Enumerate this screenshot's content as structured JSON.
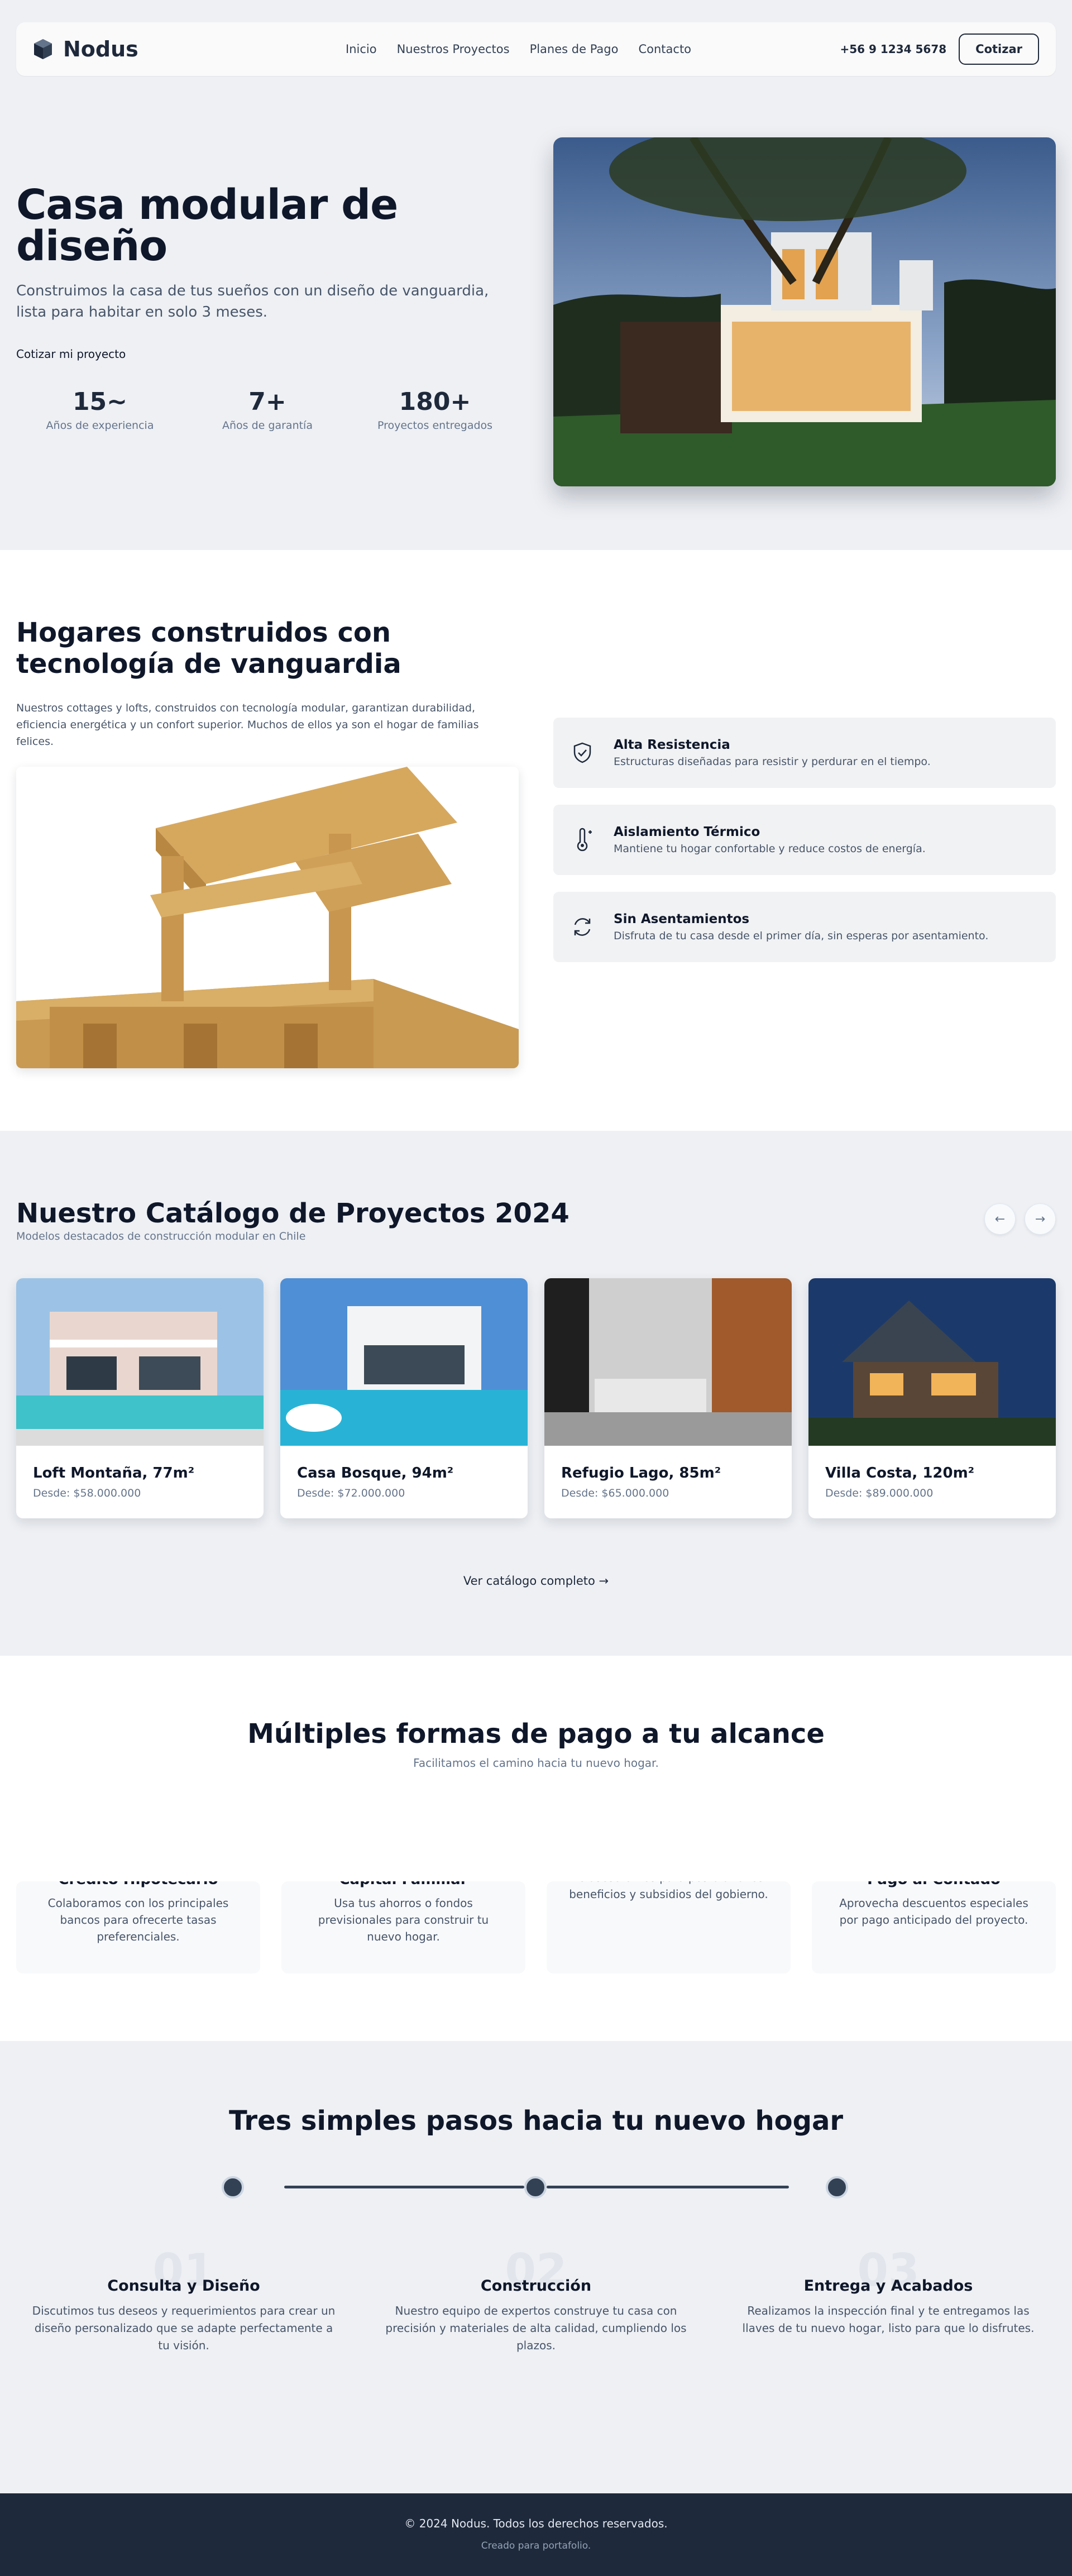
{
  "nav": {
    "logo_text": "Nodus",
    "links": [
      "Inicio",
      "Nuestros Proyectos",
      "Planes de Pago",
      "Contacto"
    ],
    "phone": "+56 9 1234 5678",
    "cta": "Cotizar"
  },
  "hero": {
    "title": "Casa modular de diseño",
    "subtitle": "Construimos la casa de tus sueños con un diseño de vanguardia, lista para habitar en solo 3 meses.",
    "link": "Cotizar mi proyecto",
    "stats": [
      {
        "value": "15~",
        "label": "Años de experiencia"
      },
      {
        "value": "7+",
        "label": "Años de garantía"
      },
      {
        "value": "180+",
        "label": "Proyectos entregados"
      }
    ]
  },
  "features": {
    "title": "Hogares construidos con tecnología de vanguardia",
    "description": "Nuestros cottages y lofts, construidos con tecnología modular, garantizan durabilidad, eficiencia energética y un confort superior. Muchos de ellos ya son el hogar de familias felices.",
    "items": [
      {
        "title": "Alta Resistencia",
        "desc": "Estructuras diseñadas para resistir y perdurar en el tiempo.",
        "icon": "shield-icon"
      },
      {
        "title": "Aislamiento Térmico",
        "desc": "Mantiene tu hogar confortable y reduce costos de energía.",
        "icon": "thermometer-icon"
      },
      {
        "title": "Sin Asentamientos",
        "desc": "Disfruta de tu casa desde el primer día, sin esperas por asentamiento.",
        "icon": "refresh-icon"
      }
    ]
  },
  "catalog": {
    "title": "Nuestro Catálogo de Proyectos 2024",
    "subtitle": "Modelos destacados de construcción modular en Chile",
    "prev": "←",
    "next": "→",
    "cards": [
      {
        "title": "Loft Montaña, 77m²",
        "price": "Desde: $58.000.000"
      },
      {
        "title": "Casa Bosque, 94m²",
        "price": "Desde: $72.000.000"
      },
      {
        "title": "Refugio Lago, 85m²",
        "price": "Desde: $65.000.000"
      },
      {
        "title": "Villa Costa, 120m²",
        "price": "Desde: $89.000.000"
      }
    ],
    "link": "Ver catálogo completo →"
  },
  "payment": {
    "title": "Múltiples formas de pago a tu alcance",
    "subtitle": "Facilitamos el camino hacia tu nuevo hogar.",
    "cards": [
      {
        "title": "Crédito Hipotecario",
        "desc": "Colaboramos con los principales bancos para ofrecerte tasas preferenciales."
      },
      {
        "title": "Capital Familiar",
        "desc": "Usa tus ahorros o fondos previsionales para construir tu nuevo hogar."
      },
      {
        "title": "",
        "desc": "Te asesoramos para postular a los beneficios y subsidios del gobierno."
      },
      {
        "title": "Pago al Contado",
        "desc": "Aprovecha descuentos especiales por pago anticipado del proyecto."
      }
    ]
  },
  "steps": {
    "title": "Tres simples pasos hacia tu nuevo hogar",
    "items": [
      {
        "num": "01",
        "title": "Consulta y Diseño",
        "desc": "Discutimos tus deseos y requerimientos para crear un diseño personalizado que se adapte perfectamente a tu visión."
      },
      {
        "num": "02",
        "title": "Construcción",
        "desc": "Nuestro equipo de expertos construye tu casa con precisión y materiales de alta calidad, cumpliendo los plazos."
      },
      {
        "num": "03",
        "title": "Entrega y Acabados",
        "desc": "Realizamos la inspección final y te entregamos las llaves de tu nuevo hogar, listo para que lo disfrutes."
      }
    ]
  },
  "footer": {
    "copy": "© 2024 Nodus. Todos los derechos reservados.",
    "credit": "Creado para portafolio."
  },
  "colors": {
    "primary": "#1e293b",
    "section_alt": "#eef0f4",
    "card_gray": "#f1f2f4"
  }
}
